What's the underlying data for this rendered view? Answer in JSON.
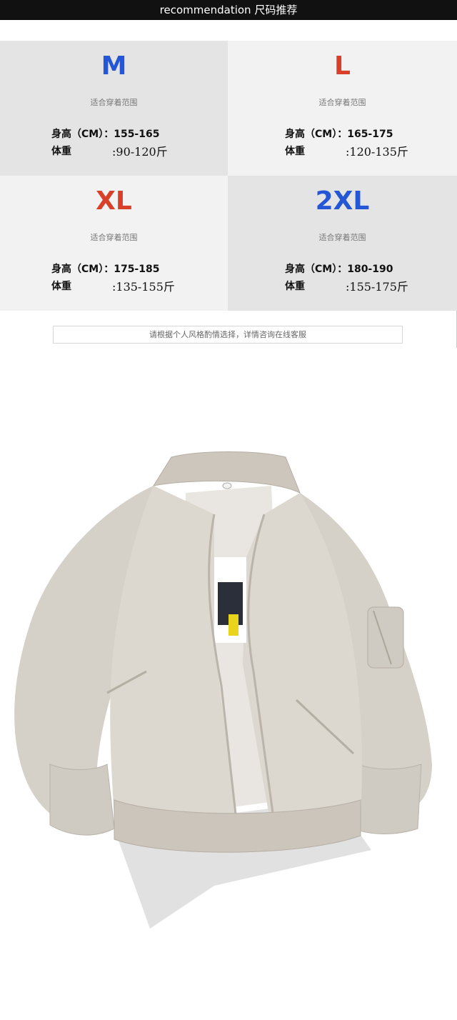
{
  "header": {
    "title": "recommendation 尺码推荐"
  },
  "sizes": [
    {
      "size": "M",
      "color": "#2456d6",
      "caption": "适合穿着范围",
      "height_label": "身高（CM）：155-165",
      "weight_label": "体重",
      "weight_value": ":90-120斤"
    },
    {
      "size": "L",
      "color": "#d8402a",
      "caption": "适合穿着范围",
      "height_label": "身高（CM）：165-175",
      "weight_label": "体重",
      "weight_value": ":120-135斤"
    },
    {
      "size": "XL",
      "color": "#d8402a",
      "caption": "适合穿着范围",
      "height_label": "身高（CM）：175-185",
      "weight_label": "体重",
      "weight_value": ":135-155斤"
    },
    {
      "size": "2XL",
      "color": "#2456d6",
      "caption": "适合穿着范围",
      "height_label": "身高（CM）：180-190",
      "weight_label": "体重",
      "weight_value": ":155-175斤"
    }
  ],
  "note": "请根据个人风格酌情选择，详情咨询在线客服",
  "product": {
    "image": "bomber-jacket-khaki",
    "fabric_color": "#d8d3cb"
  }
}
